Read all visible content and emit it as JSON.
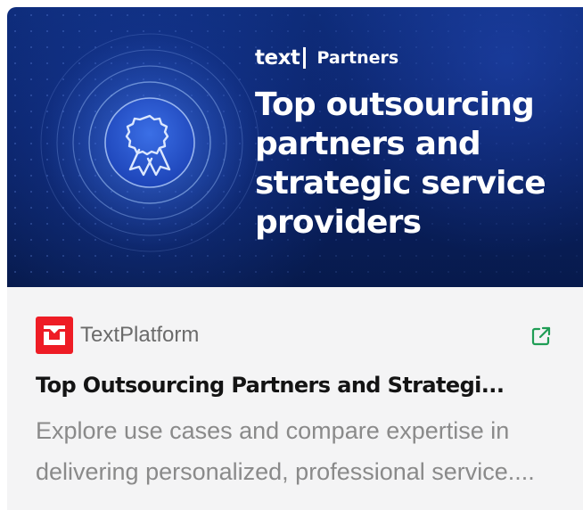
{
  "card": {
    "hero": {
      "brand_logo": "text",
      "brand_sub": "Partners",
      "title": "Top outsourcing partners and strategic service providers",
      "badge_icon": "award-ribbon-icon",
      "colors": {
        "background": "#0a2266",
        "accent": "#6fa0ff"
      }
    },
    "source": {
      "name": "TextPlatform",
      "favicon_color": "#ee1c25"
    },
    "title": "Top Outsourcing Partners and Strategi...",
    "description": "Explore use cases and compare expertise in delivering personalized, professional service....",
    "external_link_icon": "external-link-icon",
    "external_link_color": "#1f9d55"
  }
}
